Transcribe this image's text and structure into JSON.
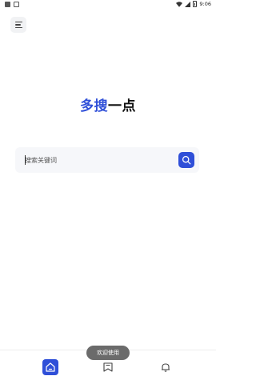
{
  "status_bar": {
    "time": "9:06",
    "icons": [
      "notification-square-icon",
      "sim-card-icon",
      "wifi-icon",
      "signal-icon",
      "battery-icon"
    ]
  },
  "header": {
    "menu_icon": "hamburger-menu-icon"
  },
  "logo": {
    "part1": "多搜",
    "part2": "一点",
    "colors": {
      "part1": "#2f4fd8",
      "part2": "#111111"
    }
  },
  "search": {
    "placeholder": "搜索关键词",
    "value": "",
    "button_icon": "search-icon"
  },
  "bottom_nav": {
    "items": [
      {
        "icon": "home-icon",
        "active": true
      },
      {
        "icon": "bookmark-icon",
        "active": false
      },
      {
        "icon": "bell-icon",
        "active": false
      }
    ]
  },
  "toast": {
    "text": "欢迎使用"
  },
  "colors": {
    "accent": "#2f4fd8",
    "toast_bg": "#6b6b6b",
    "search_bg": "#f6f7fa"
  }
}
